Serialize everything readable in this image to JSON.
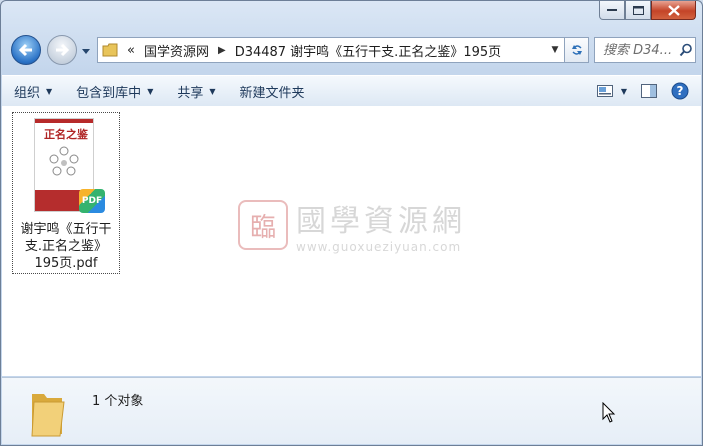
{
  "window": {
    "caption_buttons": [
      "minimize",
      "maximize",
      "close"
    ]
  },
  "address_bar": {
    "overflow_chevron": "«",
    "breadcrumbs": [
      "国学资源网",
      "D34487 谢宇鸣《五行干支.正名之鉴》195页"
    ],
    "separator_icon": "chevron-right-icon"
  },
  "search": {
    "placeholder": "搜索 D34..."
  },
  "command_bar": {
    "organize": "组织",
    "include_in_library": "包含到库中",
    "share": "共享",
    "new_folder": "新建文件夹"
  },
  "files": [
    {
      "name": "谢宇鸣《五行干支.正名之鉴》195页.pdf",
      "thumb_title": "正名之鉴",
      "badge": "PDF"
    }
  ],
  "watermark": {
    "name": "國學資源網",
    "url": "www.guoxueziyuan.com"
  },
  "details": {
    "status": "1 个对象"
  },
  "colors": {
    "accent": "#2a72c6",
    "frame": "#c4d6ec",
    "close": "#c44428"
  }
}
